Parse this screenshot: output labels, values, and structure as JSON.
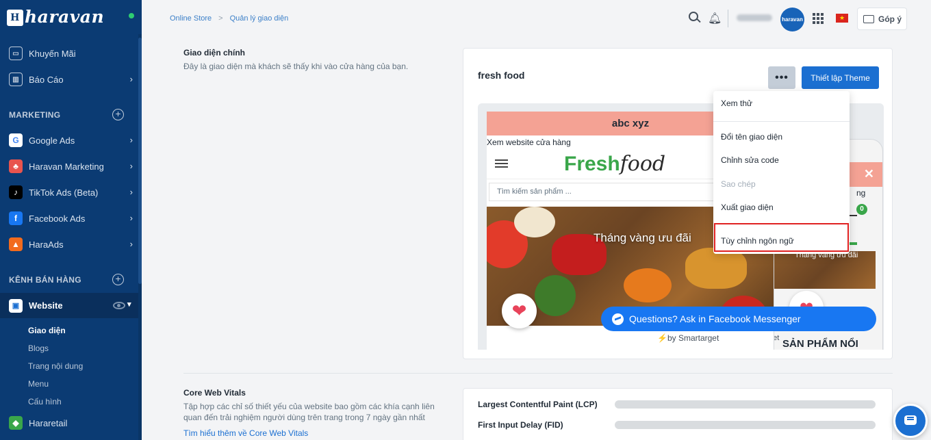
{
  "app": {
    "brand": "haravan",
    "avatar_text": "haravan"
  },
  "sidebar": {
    "items": [
      {
        "label": "Khuyến Mãi",
        "icon": "gift-icon"
      },
      {
        "label": "Báo Cáo",
        "icon": "report-icon"
      }
    ],
    "marketing_label": "MARKETING",
    "marketing_items": [
      {
        "label": "Google Ads",
        "icon": "google-icon",
        "color": "#ffffff"
      },
      {
        "label": "Haravan Marketing",
        "icon": "haravan-marketing-icon",
        "color": "#e8544e"
      },
      {
        "label": "TikTok Ads (Beta)",
        "icon": "tiktok-icon",
        "color": "#000000"
      },
      {
        "label": "Facebook Ads",
        "icon": "facebook-icon",
        "color": "#1877f2"
      },
      {
        "label": "HaraAds",
        "icon": "haraads-icon",
        "color": "#f26b1d"
      }
    ],
    "channels_label": "KÊNH BÁN HÀNG",
    "website_label": "Website",
    "website_sub": [
      "Giao diện",
      "Blogs",
      "Trang nội dung",
      "Menu",
      "Cấu hình"
    ],
    "hararetail_label": "Hararetail"
  },
  "breadcrumb": {
    "parent": "Online Store",
    "sep": ">",
    "current": "Quản lý giao diện"
  },
  "topbar": {
    "feedback_label": "Góp ý",
    "flag": "vn-flag-icon"
  },
  "main_theme": {
    "title": "Giao diện chính",
    "description": "Đây là giao diện mà khách sẽ thấy khi vào cửa hàng của bạn.",
    "theme_name": "fresh food",
    "more_label": "•••",
    "setup_button": "Thiết lập Theme"
  },
  "preview": {
    "banner": "abc xyz",
    "view_site": "Xem website cửa hàng",
    "logo_main": "Fresh",
    "logo_script": "food",
    "search_placeholder": "Tìm kiếm sản phẩm ...",
    "hero_text": "Tháng vàng ưu đãi",
    "messenger_text": "Questions? Ask in Facebook Messenger",
    "by_smartarget": "⚡by Smartarget",
    "mobile_text1": "ng",
    "mobile_cart_count": "0",
    "mobile_hero_text": "Tháng vàng ưu đãi",
    "mobile_get": "get",
    "mobile_products": "SẢN PHẨM NỔI"
  },
  "dropdown": {
    "items": [
      "Xem thử",
      "Đổi tên giao diện",
      "Chỉnh sửa code",
      "Sao chép",
      "Xuất giao diện",
      "Tùy chỉnh ngôn ngữ"
    ]
  },
  "core_web_vitals": {
    "title": "Core Web Vitals",
    "description": "Tập hợp các chỉ số thiết yếu của website bao gồm các khía cạnh liên quan đến trải nghiệm người dùng trên trang trong 7 ngày gần nhất",
    "link": "Tìm hiểu thêm về Core Web Vitals",
    "metrics": [
      "Largest Contentful Paint (LCP)",
      "First Input Delay (FID)"
    ]
  }
}
